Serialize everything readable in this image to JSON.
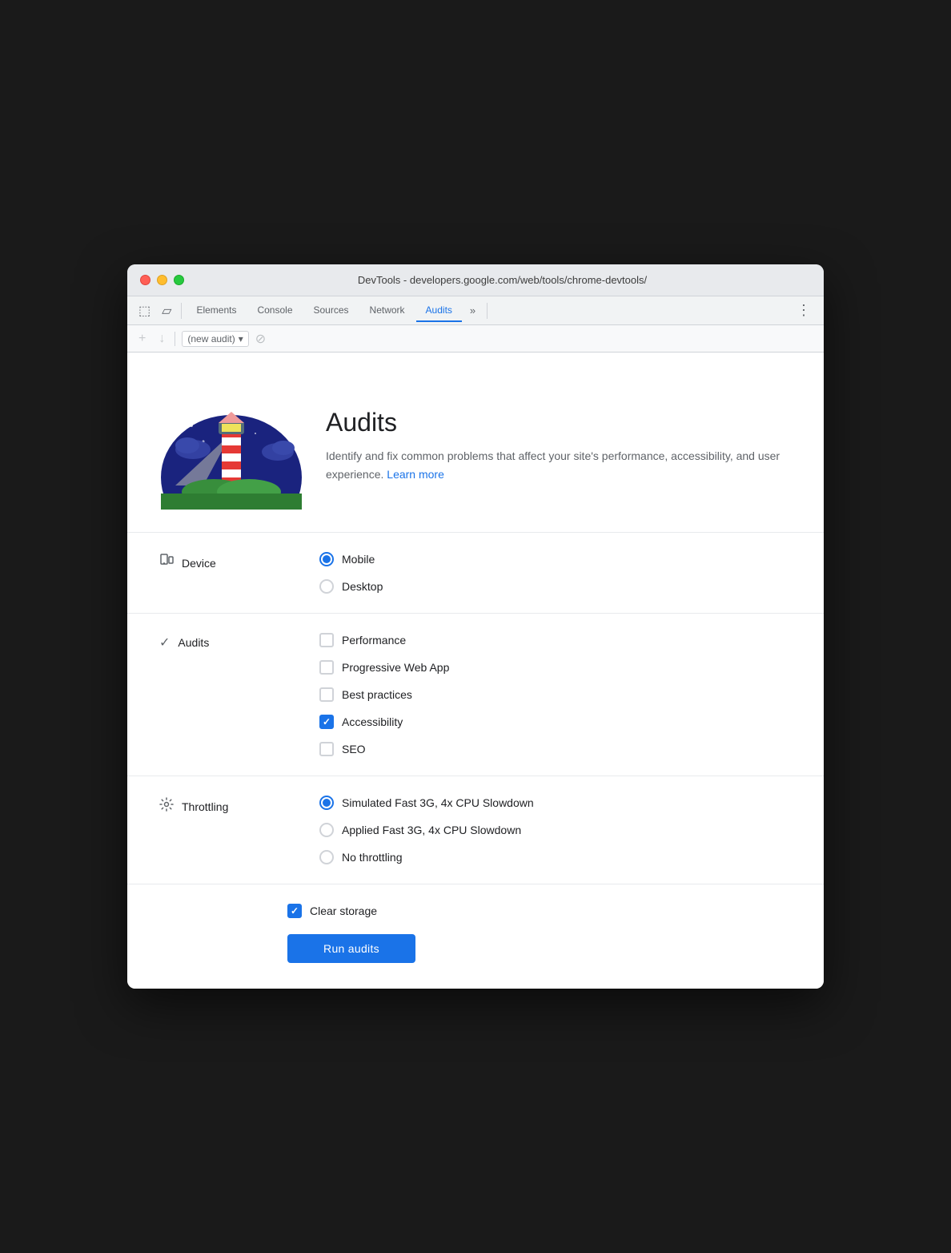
{
  "window": {
    "title": "DevTools - developers.google.com/web/tools/chrome-devtools/"
  },
  "tabs": {
    "items": [
      {
        "id": "elements",
        "label": "Elements",
        "active": false
      },
      {
        "id": "console",
        "label": "Console",
        "active": false
      },
      {
        "id": "sources",
        "label": "Sources",
        "active": false
      },
      {
        "id": "network",
        "label": "Network",
        "active": false
      },
      {
        "id": "audits",
        "label": "Audits",
        "active": true
      }
    ],
    "more_label": "»",
    "menu_label": "⋮"
  },
  "toolbar": {
    "add_label": "+",
    "download_label": "↓",
    "dropdown_label": "(new audit)",
    "dropdown_arrow": "▾",
    "stop_label": "⊘"
  },
  "hero": {
    "title": "Audits",
    "description": "Identify and fix common problems that affect your site's performance, accessibility, and user experience.",
    "learn_more": "Learn more"
  },
  "device_section": {
    "label": "Device",
    "options": [
      {
        "id": "mobile",
        "label": "Mobile",
        "selected": true
      },
      {
        "id": "desktop",
        "label": "Desktop",
        "selected": false
      }
    ]
  },
  "audits_section": {
    "label": "Audits",
    "options": [
      {
        "id": "performance",
        "label": "Performance",
        "checked": false
      },
      {
        "id": "pwa",
        "label": "Progressive Web App",
        "checked": false
      },
      {
        "id": "best-practices",
        "label": "Best practices",
        "checked": false
      },
      {
        "id": "accessibility",
        "label": "Accessibility",
        "checked": true
      },
      {
        "id": "seo",
        "label": "SEO",
        "checked": false
      }
    ]
  },
  "throttling_section": {
    "label": "Throttling",
    "options": [
      {
        "id": "simulated",
        "label": "Simulated Fast 3G, 4x CPU Slowdown",
        "selected": true
      },
      {
        "id": "applied",
        "label": "Applied Fast 3G, 4x CPU Slowdown",
        "selected": false
      },
      {
        "id": "none",
        "label": "No throttling",
        "selected": false
      }
    ]
  },
  "clear_storage": {
    "label": "Clear storage",
    "checked": true
  },
  "run_button": {
    "label": "Run audits"
  }
}
